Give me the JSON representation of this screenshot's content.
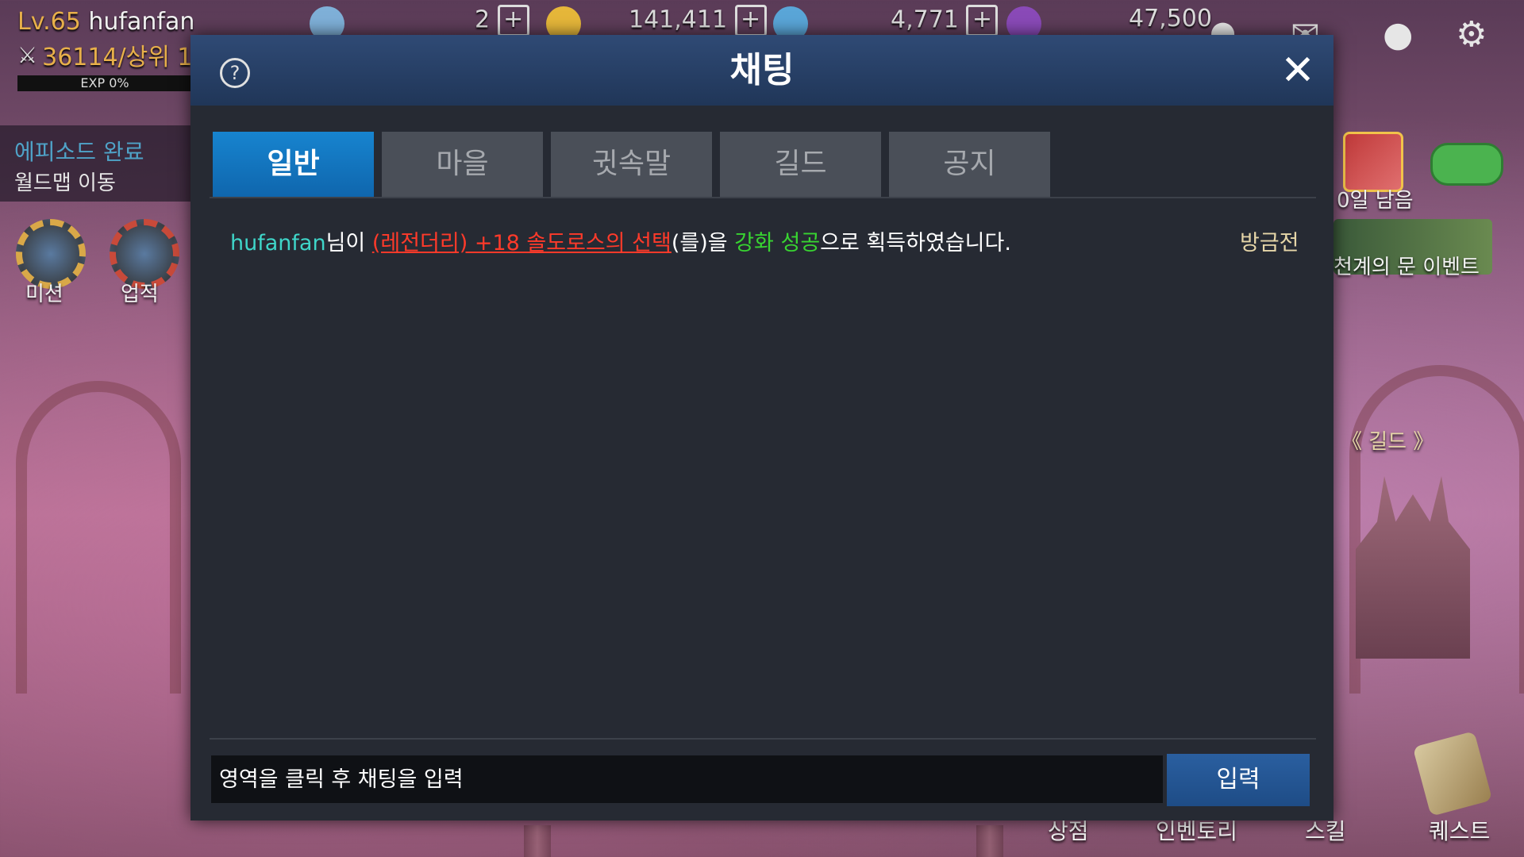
{
  "hud": {
    "level_text": "Lv.65",
    "player_name": "hufanfan",
    "rank_text": "36114/상위 1",
    "exp_text": "EXP 0%",
    "currency1": "2",
    "currency2": "141,411",
    "currency3": "4,771",
    "currency4": "47,500"
  },
  "left_panel": {
    "episode_text": "에피소드 완료",
    "worldmap_text": "월드맵 이동",
    "mission_label": "미션",
    "achievement_label": "업적"
  },
  "right_panel": {
    "days_left": "0일 남음",
    "event_label": "천계의 문 이벤트",
    "guild_label": "《 길드 》"
  },
  "bottom_bar": {
    "shop": "상점",
    "inventory": "인벤토리",
    "skill": "스킬",
    "quest": "퀘스트"
  },
  "chat": {
    "title": "채팅",
    "help_glyph": "?",
    "close_glyph": "✕",
    "tabs": [
      {
        "label": "일반",
        "active": true
      },
      {
        "label": "마을",
        "active": false
      },
      {
        "label": "귓속말",
        "active": false
      },
      {
        "label": "길드",
        "active": false
      },
      {
        "label": "공지",
        "active": false
      }
    ],
    "message": {
      "user": "hufanfan",
      "part1": "님이 ",
      "item": "(레전더리) +18 솔도로스의 선택",
      "part2": "(를)을 ",
      "enhance": "강화 성공",
      "part3": "으로 획득하였습니다.",
      "time": "방금전"
    },
    "input_placeholder": "영역을 클릭 후 채팅을 입력",
    "send_label": "입력"
  },
  "colors": {
    "header": "#2f4a75",
    "active_tab": "#1784cf",
    "username": "#3fd6c9",
    "item_legendary": "#ff3a2a",
    "enhance_success": "#38d431",
    "timestamp": "#e6d6a8"
  }
}
